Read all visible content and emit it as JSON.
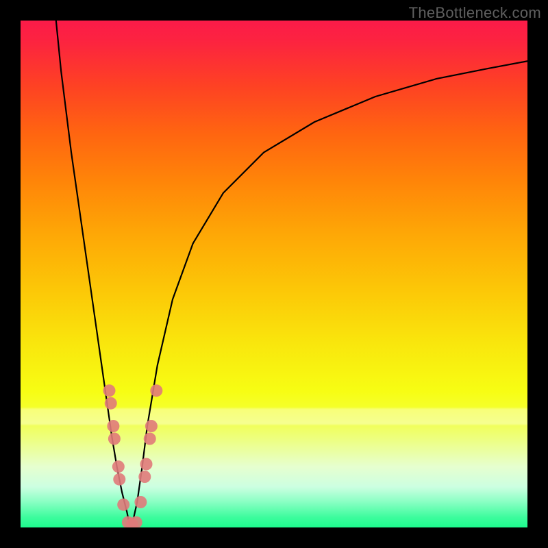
{
  "watermark": "TheBottleneck.com",
  "chart_data": {
    "type": "line",
    "title": "",
    "xlabel": "",
    "ylabel": "",
    "xlim": [
      0,
      100
    ],
    "ylim": [
      0,
      100
    ],
    "grid": false,
    "background_gradient": {
      "orientation": "vertical",
      "stops": [
        {
          "pos": 0.0,
          "color": "#FB1B49"
        },
        {
          "pos": 0.13,
          "color": "#FE4223"
        },
        {
          "pos": 0.32,
          "color": "#FF8608"
        },
        {
          "pos": 0.53,
          "color": "#FCC707"
        },
        {
          "pos": 0.73,
          "color": "#F7FD13"
        },
        {
          "pos": 0.88,
          "color": "#E6FFCF"
        },
        {
          "pos": 1.0,
          "color": "#1DFB8E"
        }
      ]
    },
    "series": [
      {
        "name": "left-curve",
        "x": [
          7,
          8,
          9,
          10,
          11,
          12,
          13,
          14,
          15,
          16,
          17,
          18,
          19,
          20,
          21,
          21.5
        ],
        "y": [
          100,
          90,
          82,
          74,
          67,
          60,
          53,
          46,
          39,
          32,
          25,
          18,
          12,
          7,
          3,
          0.5
        ],
        "stroke": "#000000"
      },
      {
        "name": "right-curve",
        "x": [
          22,
          23,
          24,
          25,
          27,
          30,
          34,
          40,
          48,
          58,
          70,
          82,
          92,
          100
        ],
        "y": [
          0.5,
          5,
          12,
          20,
          32,
          45,
          56,
          66,
          74,
          80,
          85,
          88.5,
          90.5,
          92
        ],
        "stroke": "#000000"
      }
    ],
    "markers": {
      "name": "valley-dots",
      "color": "#E07A7A",
      "radius": 9,
      "points": [
        {
          "x": 17.5,
          "y": 27
        },
        {
          "x": 17.8,
          "y": 24.5
        },
        {
          "x": 18.3,
          "y": 20
        },
        {
          "x": 18.5,
          "y": 17.5
        },
        {
          "x": 19.3,
          "y": 12
        },
        {
          "x": 19.5,
          "y": 9.5
        },
        {
          "x": 20.3,
          "y": 4.5
        },
        {
          "x": 21.2,
          "y": 1.0
        },
        {
          "x": 22.0,
          "y": 0.6
        },
        {
          "x": 22.8,
          "y": 1.0
        },
        {
          "x": 23.7,
          "y": 5.0
        },
        {
          "x": 24.5,
          "y": 10
        },
        {
          "x": 24.8,
          "y": 12.5
        },
        {
          "x": 25.5,
          "y": 17.5
        },
        {
          "x": 25.8,
          "y": 20
        },
        {
          "x": 26.8,
          "y": 27
        }
      ]
    }
  }
}
